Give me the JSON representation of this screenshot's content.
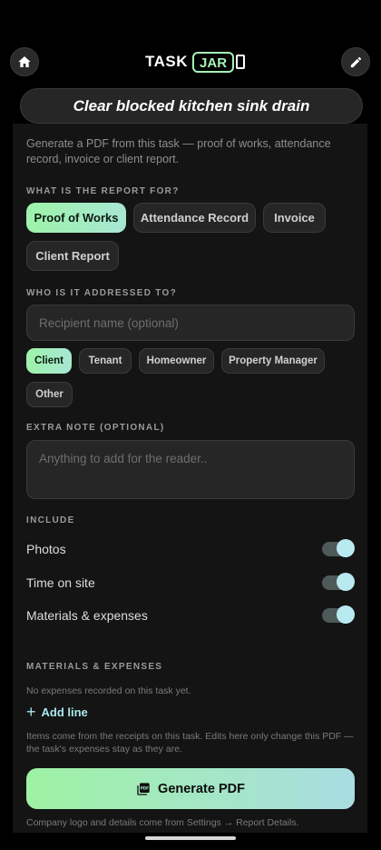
{
  "header": {
    "logo_task": "TASK",
    "logo_jar": "JAR",
    "home_icon": "home-icon",
    "edit_icon": "pencil-icon"
  },
  "task_title": "Clear blocked kitchen sink drain",
  "intro": "Generate a PDF from this task — proof of works, attendance record, invoice or client report.",
  "report_for": {
    "label": "WHAT IS THE REPORT FOR?",
    "options": [
      "Proof of Works",
      "Attendance Record",
      "Invoice",
      "Client Report"
    ],
    "selected": "Proof of Works"
  },
  "addressed_to": {
    "label": "WHO IS IT ADDRESSED TO?",
    "recipient_placeholder": "Recipient name (optional)",
    "options": [
      "Client",
      "Tenant",
      "Homeowner",
      "Property Manager",
      "Other"
    ],
    "selected": "Client"
  },
  "extra_note": {
    "label": "EXTRA NOTE (OPTIONAL)",
    "placeholder": "Anything to add for the reader.."
  },
  "include": {
    "label": "INCLUDE",
    "items": [
      {
        "label": "Photos",
        "on": true
      },
      {
        "label": "Time on site",
        "on": true
      },
      {
        "label": "Materials & expenses",
        "on": true
      }
    ]
  },
  "materials": {
    "label": "MATERIALS & EXPENSES",
    "empty_text": "No expenses recorded on this task yet.",
    "add_line": "Add line",
    "note": "Items come from the receipts on this task. Edits here only change this PDF — the task's expenses stay as they are."
  },
  "generate_button": "Generate PDF",
  "footer_note": "Company logo and details come from Settings → Report Details.",
  "colors": {
    "accent_green": "#9df3a9",
    "accent_teal": "#a8e6d4",
    "toggle_knob": "#b9eaf0"
  }
}
